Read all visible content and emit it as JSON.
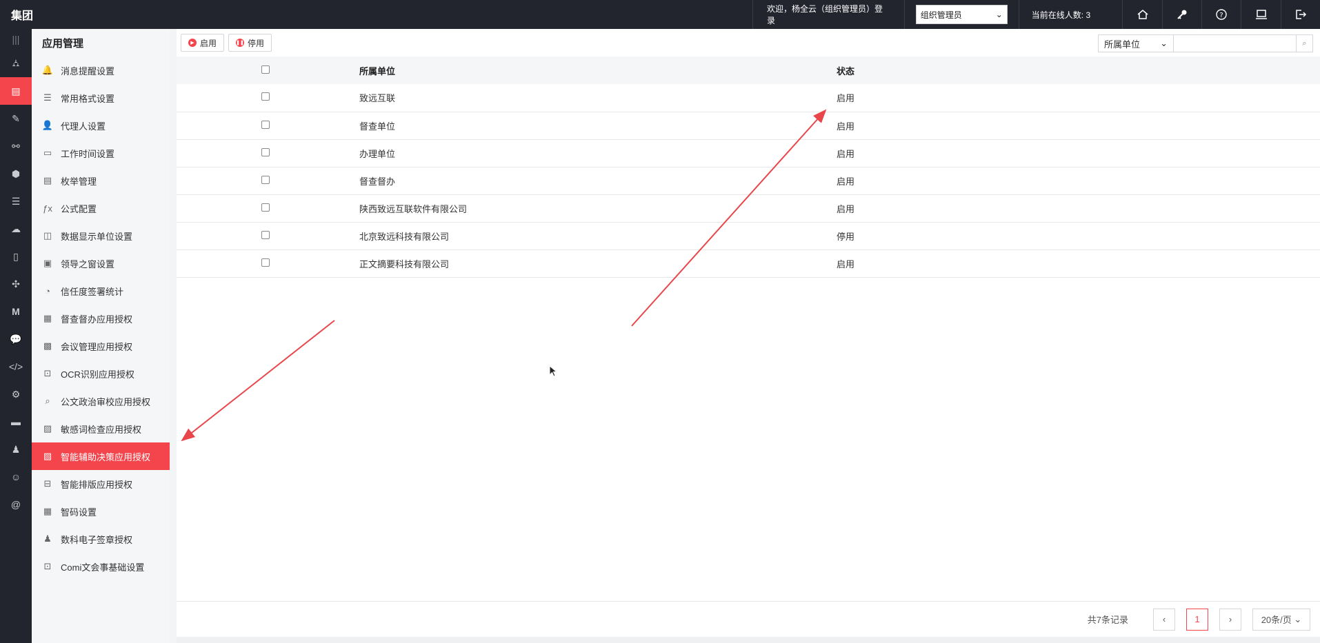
{
  "header": {
    "brand": "集团",
    "welcome": "欢迎，杨全云（组织管理员）登录",
    "role_selected": "组织管理员",
    "online": "当前在线人数: 3"
  },
  "submenu": {
    "title": "应用管理",
    "items": [
      {
        "label": "消息提醒设置",
        "icon": "bell-icon",
        "glyph": "🔔"
      },
      {
        "label": "常用格式设置",
        "icon": "format-list-icon",
        "glyph": "☰"
      },
      {
        "label": "代理人设置",
        "icon": "agent-icon",
        "glyph": "👤"
      },
      {
        "label": "工作时间设置",
        "icon": "monitor-clock-icon",
        "glyph": "▭"
      },
      {
        "label": "枚举管理",
        "icon": "document-icon",
        "glyph": "▤"
      },
      {
        "label": "公式配置",
        "icon": "formula-icon",
        "glyph": "ƒx"
      },
      {
        "label": "数据显示单位设置",
        "icon": "unit-settings-icon",
        "glyph": "◫"
      },
      {
        "label": "领导之窗设置",
        "icon": "window-icon",
        "glyph": "▣"
      },
      {
        "label": "信任度签署统计",
        "icon": "pie-chart-icon",
        "glyph": "◔"
      },
      {
        "label": "督查督办应用授权",
        "icon": "supervise-icon",
        "glyph": "▦"
      },
      {
        "label": "会议管理应用授权",
        "icon": "meeting-icon",
        "glyph": "▩"
      },
      {
        "label": "OCR识别应用授权",
        "icon": "scan-icon",
        "glyph": "⊡"
      },
      {
        "label": "公文政治审校应用授权",
        "icon": "search-doc-icon",
        "glyph": "⌕"
      },
      {
        "label": "敏感词检查应用授权",
        "icon": "sensitive-word-icon",
        "glyph": "▨"
      },
      {
        "label": "智能辅助决策应用授权",
        "icon": "decision-icon",
        "glyph": "▧"
      },
      {
        "label": "智能排版应用授权",
        "icon": "layout-icon",
        "glyph": "⊟"
      },
      {
        "label": "智码设置",
        "icon": "qrcode-icon",
        "glyph": "▦"
      },
      {
        "label": "数科电子签章授权",
        "icon": "stamp-icon",
        "glyph": "♟"
      },
      {
        "label": "Comi文会事基础设置",
        "icon": "comi-icon",
        "glyph": "⊡"
      }
    ]
  },
  "toolbar": {
    "enable_label": "启用",
    "disable_label": "停用",
    "filter_field": "所属单位",
    "search_value": ""
  },
  "table": {
    "columns": [
      "所属单位",
      "状态"
    ],
    "rows": [
      {
        "unit": "致远互联",
        "status": "启用"
      },
      {
        "unit": "督查单位",
        "status": "启用"
      },
      {
        "unit": "办理单位",
        "status": "启用"
      },
      {
        "unit": "督查督办",
        "status": "启用"
      },
      {
        "unit": "陕西致远互联软件有限公司",
        "status": "启用"
      },
      {
        "unit": "北京致远科技有限公司",
        "status": "停用"
      },
      {
        "unit": "正文摘要科技有限公司",
        "status": "启用"
      }
    ]
  },
  "pager": {
    "total": "共7条记录",
    "current_page": "1",
    "page_size": "20条/页"
  },
  "colors": {
    "accent": "#f5454c",
    "header_bg": "#23252e",
    "arrow": "#e8464b"
  }
}
